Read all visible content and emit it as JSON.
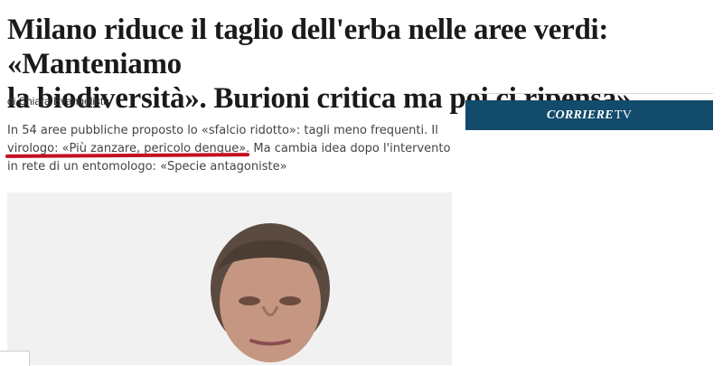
{
  "article": {
    "headline_line1": "Milano riduce il taglio dell'erba nelle aree verdi: «Manteniamo",
    "headline_line2": "la biodiversità». Burioni critica ma poi ci ripensa»",
    "byline_prefix": "di",
    "author": "Chiara Evangelista",
    "summary_before": "In 54 aree pubbliche proposto lo «sfalcio ridotto»: tagli meno frequenti. Il ",
    "summary_underlined": "virologo: «Più zanzare, pericolo dengue»",
    "summary_after": ". Ma cambia idea dopo l'intervento in rete di un entomologo: «Specie antagoniste»"
  },
  "sidebar": {
    "tv_brand": "CORRIERE",
    "tv_suffix": "TV"
  },
  "colors": {
    "underline": "#c4101f",
    "tv_banner": "#124b6b"
  }
}
